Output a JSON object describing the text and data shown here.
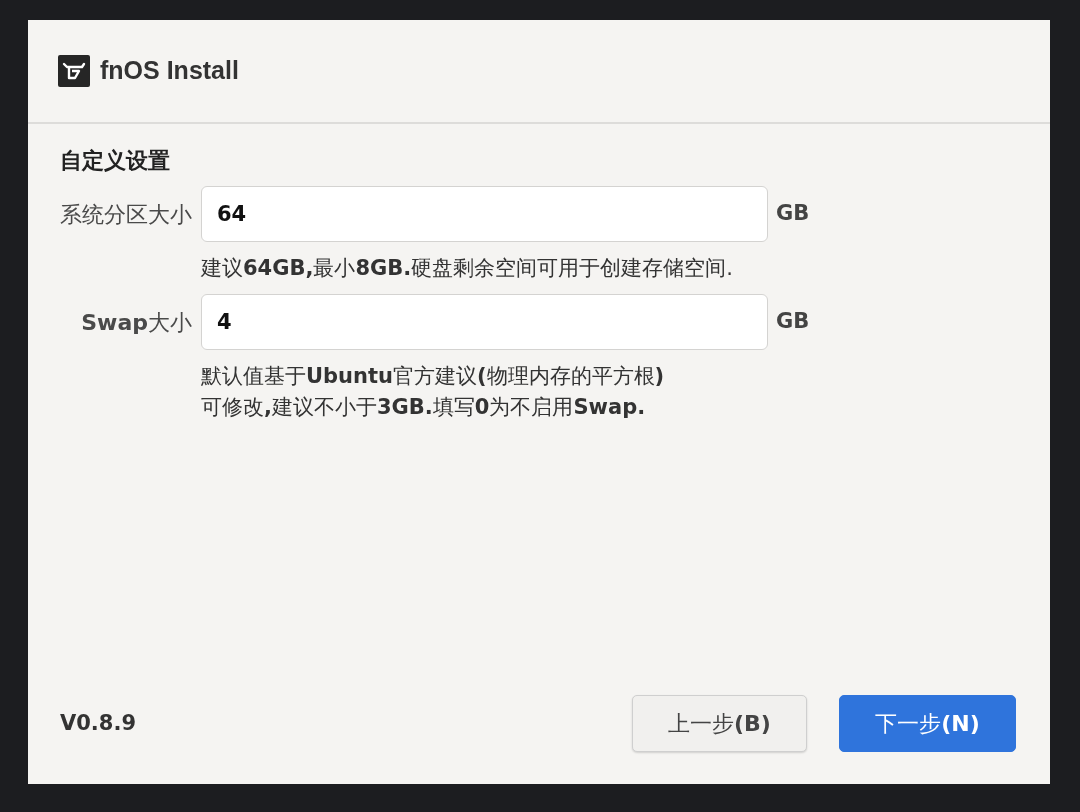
{
  "window": {
    "title": "fnOS Install"
  },
  "section": {
    "title": "自定义设置"
  },
  "fields": [
    {
      "label": "系统分区大小",
      "value": "64",
      "unit": "GB",
      "hints": [
        "建议**64GB,**最小**8GB.**硬盘剩余空间可用于创建存储空间."
      ]
    },
    {
      "label": "**Swap**大小",
      "value": "4",
      "unit": "GB",
      "hints": [
        "默认值基于**Ubuntu**官方建议**(**物理内存的平方根**)**",
        "可修改**,**建议不小于**3GB.**填写**0**为不启用**Swap.**"
      ]
    }
  ],
  "footer": {
    "version": "V0.8.9",
    "buttons": [
      {
        "label": "上一步**(B)**",
        "kind": "secondary"
      },
      {
        "label": "下一步**(N)**",
        "kind": "primary"
      }
    ]
  }
}
